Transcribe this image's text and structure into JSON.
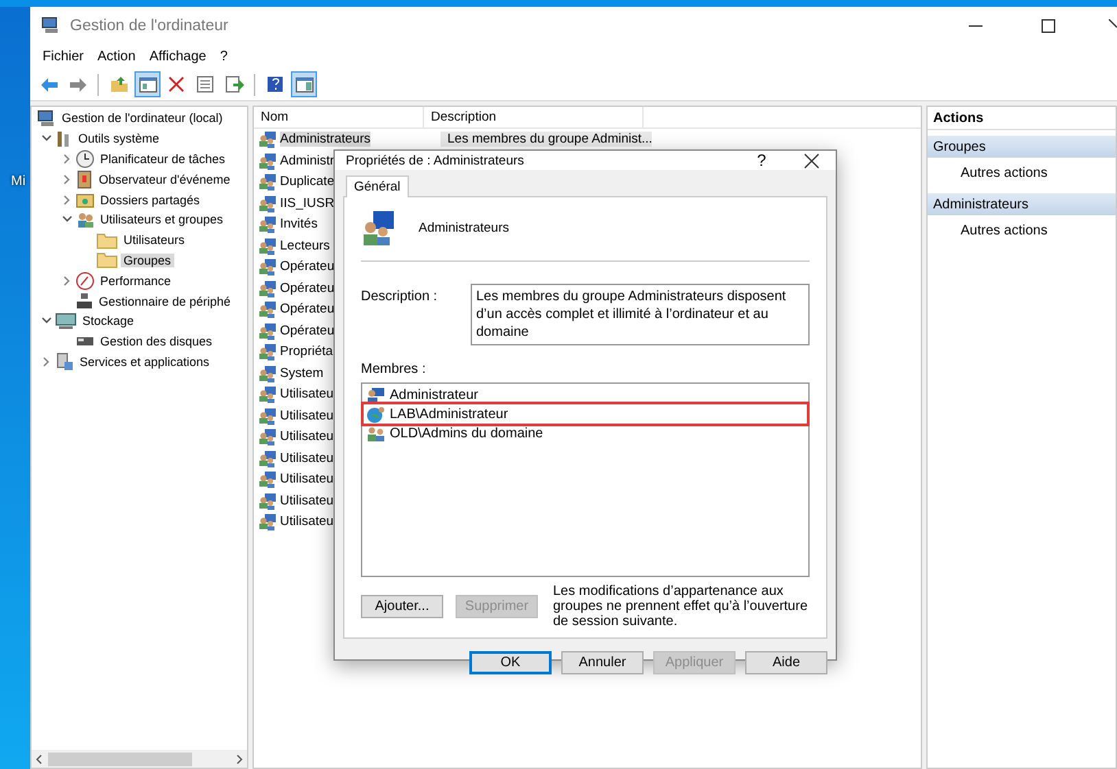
{
  "desktop_label": "Mi",
  "window": {
    "title": "Gestion de l'ordinateur"
  },
  "menu": [
    "Fichier",
    "Action",
    "Affichage",
    "?"
  ],
  "toolbar": [
    {
      "kind": "back",
      "pressed": false
    },
    {
      "kind": "forward",
      "pressed": false
    },
    {
      "kind": "separator"
    },
    {
      "kind": "up",
      "pressed": false
    },
    {
      "kind": "tree",
      "pressed": true
    },
    {
      "kind": "delete",
      "pressed": false
    },
    {
      "kind": "properties",
      "pressed": false
    },
    {
      "kind": "export",
      "pressed": false
    },
    {
      "kind": "separator"
    },
    {
      "kind": "help",
      "pressed": false
    },
    {
      "kind": "actions",
      "pressed": true
    }
  ],
  "tree": [
    {
      "label": "Gestion de l'ordinateur (local)",
      "kind": "computer",
      "selected": false,
      "children": [
        {
          "label": "Outils système",
          "kind": "tools",
          "selected": false,
          "expanded": true,
          "children": [
            {
              "label": "Planificateur de tâches",
              "kind": "clock",
              "selected": false,
              "expanded": false
            },
            {
              "label": "Observateur d'événeme",
              "kind": "log",
              "selected": false,
              "expanded": false
            },
            {
              "label": "Dossiers partagés",
              "kind": "share",
              "selected": false,
              "expanded": false
            },
            {
              "label": "Utilisateurs et groupes",
              "kind": "users",
              "selected": false,
              "expanded": true,
              "children": [
                {
                  "label": "Utilisateurs",
                  "kind": "folder",
                  "selected": false
                },
                {
                  "label": "Groupes",
                  "kind": "folder",
                  "selected": true
                }
              ]
            },
            {
              "label": "Performance",
              "kind": "gauge",
              "selected": false,
              "expanded": false
            },
            {
              "label": "Gestionnaire de périphé",
              "kind": "device",
              "selected": false
            }
          ]
        },
        {
          "label": "Stockage",
          "kind": "storage",
          "selected": false,
          "expanded": true,
          "children": [
            {
              "label": "Gestion des disques",
              "kind": "disk",
              "selected": false
            }
          ]
        },
        {
          "label": "Services et applications",
          "kind": "services",
          "selected": false,
          "expanded": false
        }
      ]
    }
  ],
  "list": {
    "columns": [
      "Nom",
      "Description"
    ],
    "rows": [
      {
        "name": "Administrateurs",
        "description": "Les membres du groupe Administ...",
        "selected": true
      },
      {
        "name": "Administr",
        "selected": false
      },
      {
        "name": "Duplicate",
        "selected": false
      },
      {
        "name": "IIS_IUSR",
        "selected": false
      },
      {
        "name": "Invités",
        "selected": false
      },
      {
        "name": "Lecteurs",
        "selected": false
      },
      {
        "name": "Opérateu",
        "selected": false
      },
      {
        "name": "Opérateu",
        "selected": false
      },
      {
        "name": "Opérateu",
        "selected": false
      },
      {
        "name": "Opérateu",
        "selected": false
      },
      {
        "name": "Propriéta",
        "selected": false
      },
      {
        "name": "System",
        "selected": false
      },
      {
        "name": "Utilisateu",
        "selected": false
      },
      {
        "name": "Utilisateu",
        "selected": false
      },
      {
        "name": "Utilisateu",
        "selected": false
      },
      {
        "name": "Utilisateu",
        "selected": false
      },
      {
        "name": "Utilisateu",
        "selected": false
      },
      {
        "name": "Utilisateu",
        "selected": false
      },
      {
        "name": "Utilisateu",
        "selected": false
      }
    ]
  },
  "actions": {
    "title": "Actions",
    "sections": [
      {
        "heading": "Groupes",
        "items": [
          "Autres actions"
        ]
      },
      {
        "heading": "Administrateurs",
        "items": [
          "Autres actions"
        ]
      }
    ]
  },
  "dialog": {
    "title": "Propriétés de : Administrateurs",
    "help": "?",
    "tabs": [
      {
        "label": "Général",
        "selected": true
      }
    ],
    "group_name": "Administrateurs",
    "description_label": "Description :",
    "description": "Les membres du groupe Administrateurs disposent d’un accès complet et illimité à l’ordinateur et au domaine",
    "members_label": "Membres :",
    "members": [
      {
        "name": "Administrateur",
        "kind": "user",
        "highlighted": false
      },
      {
        "name": "LAB\\Administrateur",
        "kind": "domain-user",
        "highlighted": true
      },
      {
        "name": "OLD\\Admins du domaine",
        "kind": "group",
        "highlighted": false
      }
    ],
    "buttons": [
      {
        "label": "Ajouter...",
        "disabled": false
      },
      {
        "label": "Supprimer",
        "disabled": true
      }
    ],
    "note": "Les modifications d’appartenance aux groupes ne prennent effet qu’à l’ouverture de session suivante.",
    "footer_buttons": [
      {
        "label": "OK",
        "disabled": false,
        "default": true
      },
      {
        "label": "Annuler",
        "disabled": false,
        "default": false
      },
      {
        "label": "Appliquer",
        "disabled": true,
        "default": false
      },
      {
        "label": "Aide",
        "disabled": false,
        "default": false
      }
    ]
  }
}
